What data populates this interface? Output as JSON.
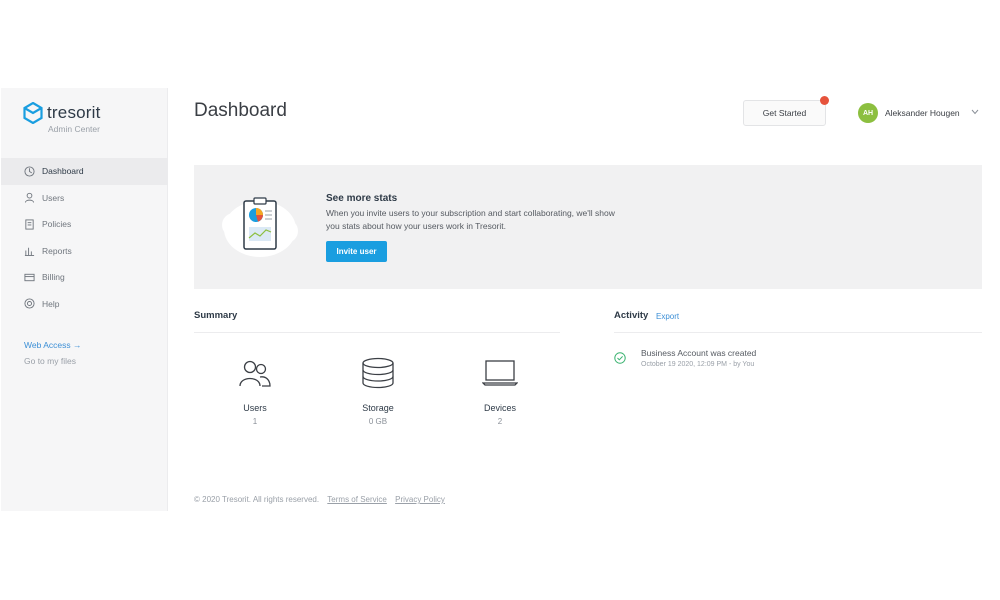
{
  "brand": {
    "name": "tresorit",
    "subtitle": "Admin Center",
    "accent": "#1a9ee0"
  },
  "sidebar": {
    "items": [
      {
        "label": "Dashboard",
        "icon": "dashboard-icon",
        "active": true
      },
      {
        "label": "Users",
        "icon": "user-icon"
      },
      {
        "label": "Policies",
        "icon": "document-icon"
      },
      {
        "label": "Reports",
        "icon": "bar-chart-icon"
      },
      {
        "label": "Billing",
        "icon": "credit-card-icon"
      },
      {
        "label": "Help",
        "icon": "lifebuoy-icon"
      }
    ],
    "web_access": "Web Access →",
    "go_to_files": "Go to my files"
  },
  "header": {
    "title": "Dashboard",
    "get_started": "Get Started",
    "user": {
      "initials": "AH",
      "name": "Aleksander Hougen",
      "avatar_color": "#8cbf3f"
    }
  },
  "stats_banner": {
    "title": "See more stats",
    "text": "When you invite users to your subscription and start collaborating, we'll show you stats about how your users work in Tresorit.",
    "button": "Invite user"
  },
  "summary": {
    "title": "Summary",
    "items": [
      {
        "label": "Users",
        "value": "1",
        "icon": "users-icon"
      },
      {
        "label": "Storage",
        "value": "0 GB",
        "icon": "database-icon"
      },
      {
        "label": "Devices",
        "value": "2",
        "icon": "laptop-icon"
      }
    ]
  },
  "activity": {
    "title": "Activity",
    "export": "Export",
    "entries": [
      {
        "text": "Business Account was created",
        "meta": "October 19 2020, 12:09 PM - by You",
        "icon": "check-circle-icon"
      }
    ]
  },
  "footer": {
    "copyright": "© 2020 Tresorit. All rights reserved.",
    "terms": "Terms of Service",
    "privacy": "Privacy Policy"
  }
}
